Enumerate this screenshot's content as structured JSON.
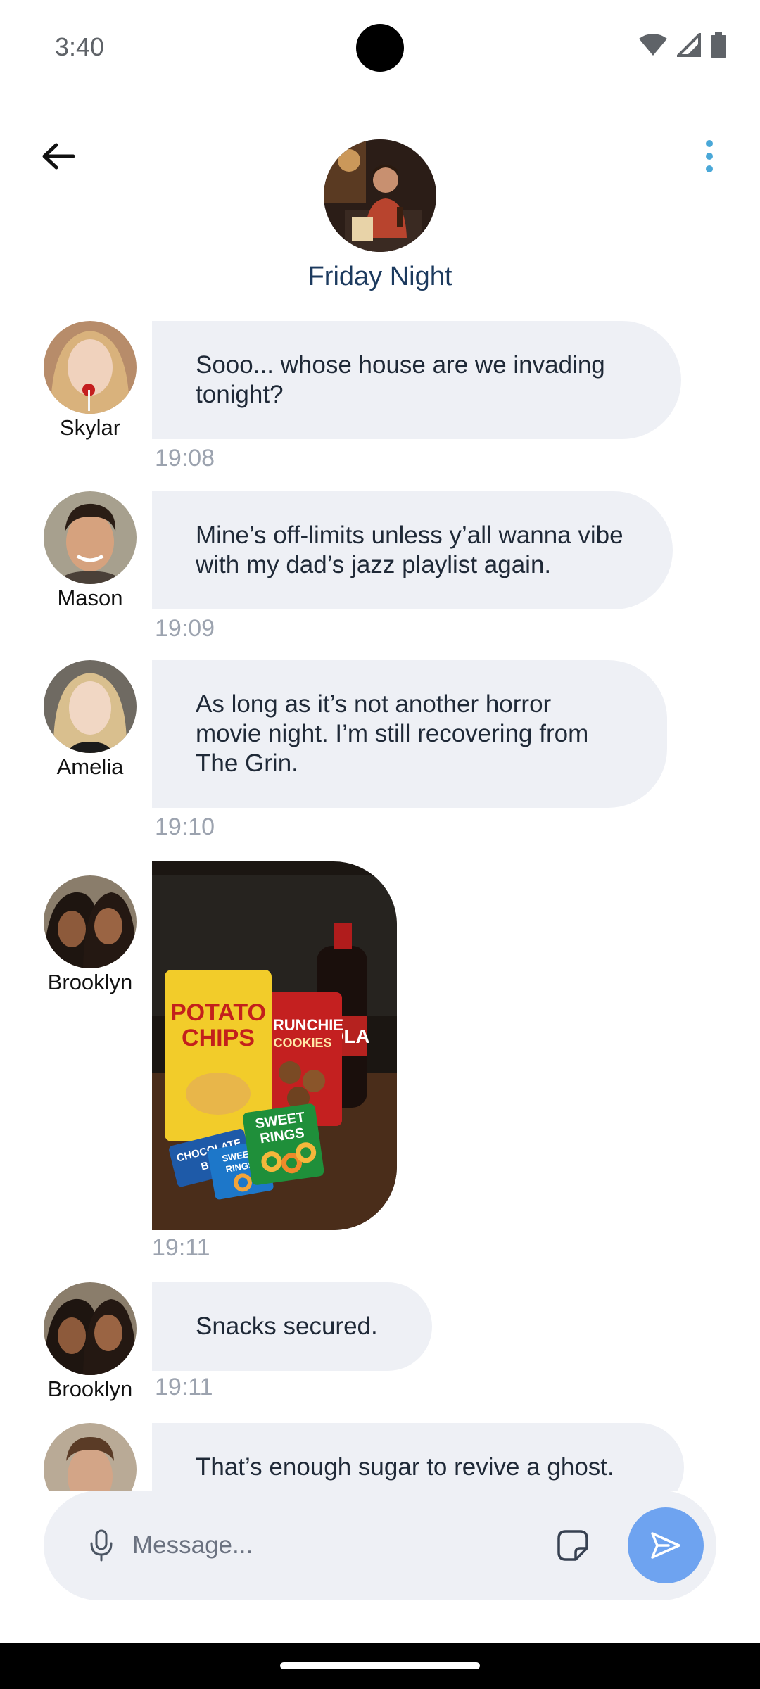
{
  "status": {
    "time": "3:40"
  },
  "header": {
    "title": "Friday Night"
  },
  "messages": [
    {
      "sender": "Skylar",
      "text": "Sooo... whose house are we invading tonight?",
      "time": "19:08"
    },
    {
      "sender": "Mason",
      "text": "Mine’s off-limits unless y’all wanna vibe with my dad’s jazz playlist again.",
      "time": "19:09"
    },
    {
      "sender": "Amelia",
      "text": "As long as it’s not another horror movie night. I’m still recovering from The Grin.",
      "time": "19:10"
    },
    {
      "sender": "Brooklyn",
      "image": {
        "labels": [
          "POTATO",
          "CHIPS",
          "CRUNCHIE",
          "COOKIES",
          "COLA",
          "CHOCOLATE",
          "BAR",
          "SWEET",
          "RINGS",
          "SWEET",
          "RINGS"
        ]
      },
      "time": "19:11"
    },
    {
      "sender": "Brooklyn",
      "text": "Snacks secured.",
      "time": "19:11"
    },
    {
      "sender": "",
      "text": "That’s enough sugar to revive a ghost."
    }
  ],
  "composer": {
    "placeholder": "Message..."
  },
  "colors": {
    "accent": "#6ea3f0",
    "bubble": "#eef0f5",
    "title": "#1c3a5e",
    "more": "#4aa8d8"
  }
}
